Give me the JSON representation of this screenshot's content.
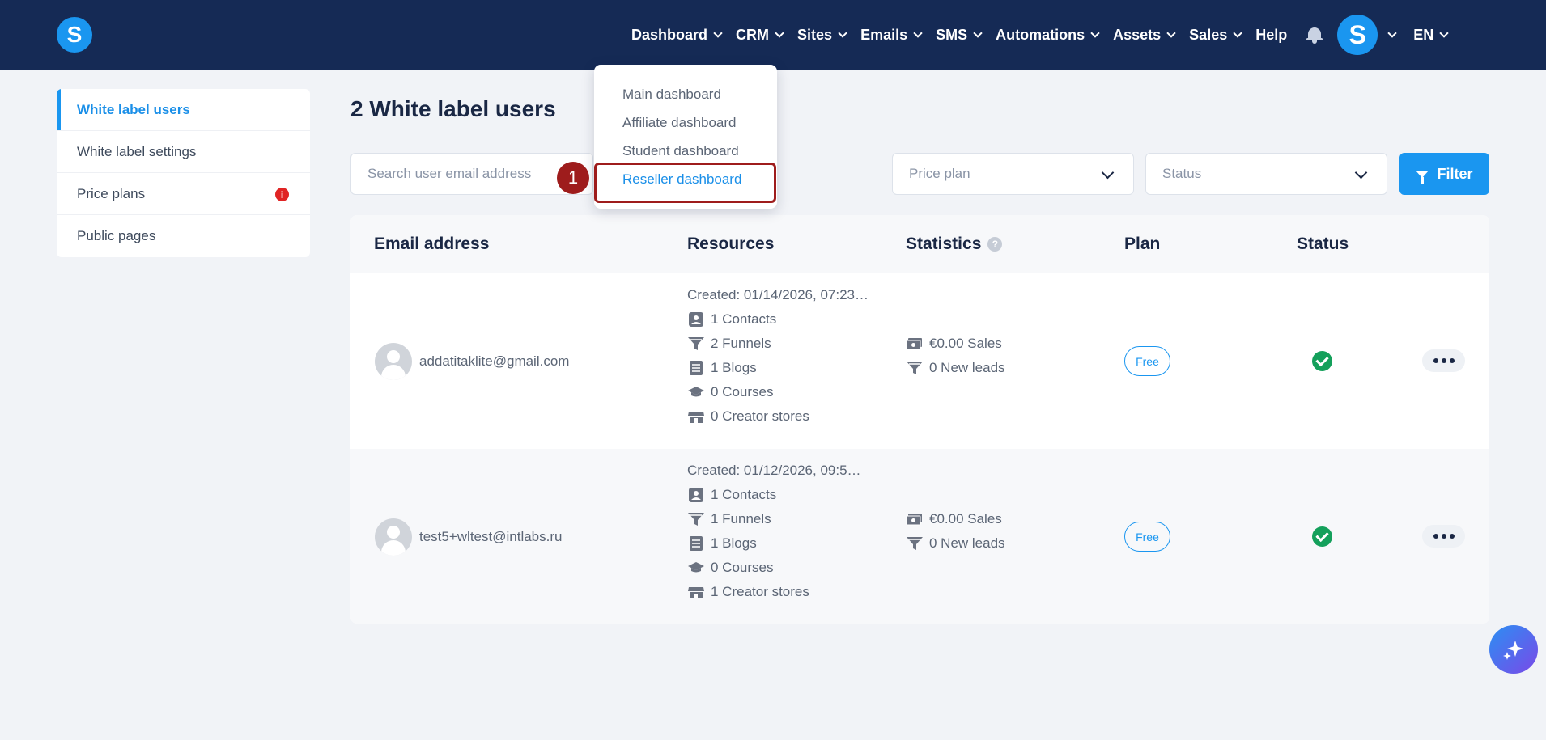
{
  "brand": {
    "logo_letter": "S"
  },
  "nav": {
    "items": [
      {
        "label": "Dashboard",
        "has_dropdown": true
      },
      {
        "label": "CRM",
        "has_dropdown": true
      },
      {
        "label": "Sites",
        "has_dropdown": true
      },
      {
        "label": "Emails",
        "has_dropdown": true
      },
      {
        "label": "SMS",
        "has_dropdown": true
      },
      {
        "label": "Automations",
        "has_dropdown": true
      },
      {
        "label": "Assets",
        "has_dropdown": true
      },
      {
        "label": "Sales",
        "has_dropdown": true
      },
      {
        "label": "Help",
        "has_dropdown": false
      }
    ],
    "avatar_letter": "S",
    "language": "EN",
    "icons": {
      "notifications": "bell-icon"
    }
  },
  "dashboard_menu": {
    "items": [
      {
        "label": "Main dashboard"
      },
      {
        "label": "Affiliate dashboard"
      },
      {
        "label": "Student dashboard"
      },
      {
        "label": "Reseller dashboard"
      }
    ],
    "highlighted_index": 3,
    "step_number": "1"
  },
  "sidebar": {
    "items": [
      {
        "label": "White label users",
        "active": true
      },
      {
        "label": "White label settings",
        "active": false
      },
      {
        "label": "Price plans",
        "active": false,
        "badge": "i"
      },
      {
        "label": "Public pages",
        "active": false
      }
    ]
  },
  "main": {
    "title": "2 White label users",
    "search": {
      "placeholder": "Search user email address",
      "value": ""
    },
    "price_plan_select": {
      "placeholder": "Price plan"
    },
    "status_select": {
      "placeholder": "Status"
    },
    "filter_label": "Filter"
  },
  "table": {
    "headers": {
      "email": "Email address",
      "resources": "Resources",
      "statistics": "Statistics",
      "statistics_help": "?",
      "plan": "Plan",
      "status": "Status"
    },
    "rows": [
      {
        "email": "addatitaklite@gmail.com",
        "created": "Created: 01/14/2026, 07:23…",
        "contacts": "1 Contacts",
        "funnels": "2 Funnels",
        "blogs": "1 Blogs",
        "courses": "0 Courses",
        "stores": "0 Creator stores",
        "sales": "€0.00 Sales",
        "leads": "0 New leads",
        "plan": "Free",
        "status": "active"
      },
      {
        "email": "test5+wltest@intlabs.ru",
        "created": "Created: 01/12/2026, 09:5…",
        "contacts": "1 Contacts",
        "funnels": "1 Funnels",
        "blogs": "1 Blogs",
        "courses": "0 Courses",
        "stores": "1 Creator stores",
        "sales": "€0.00 Sales",
        "leads": "0 New leads",
        "plan": "Free",
        "status": "active"
      }
    ]
  },
  "colors": {
    "nav_bg": "#152a55",
    "accent": "#1a96f0",
    "highlight": "#9e1c1c",
    "success": "#14a05b"
  }
}
